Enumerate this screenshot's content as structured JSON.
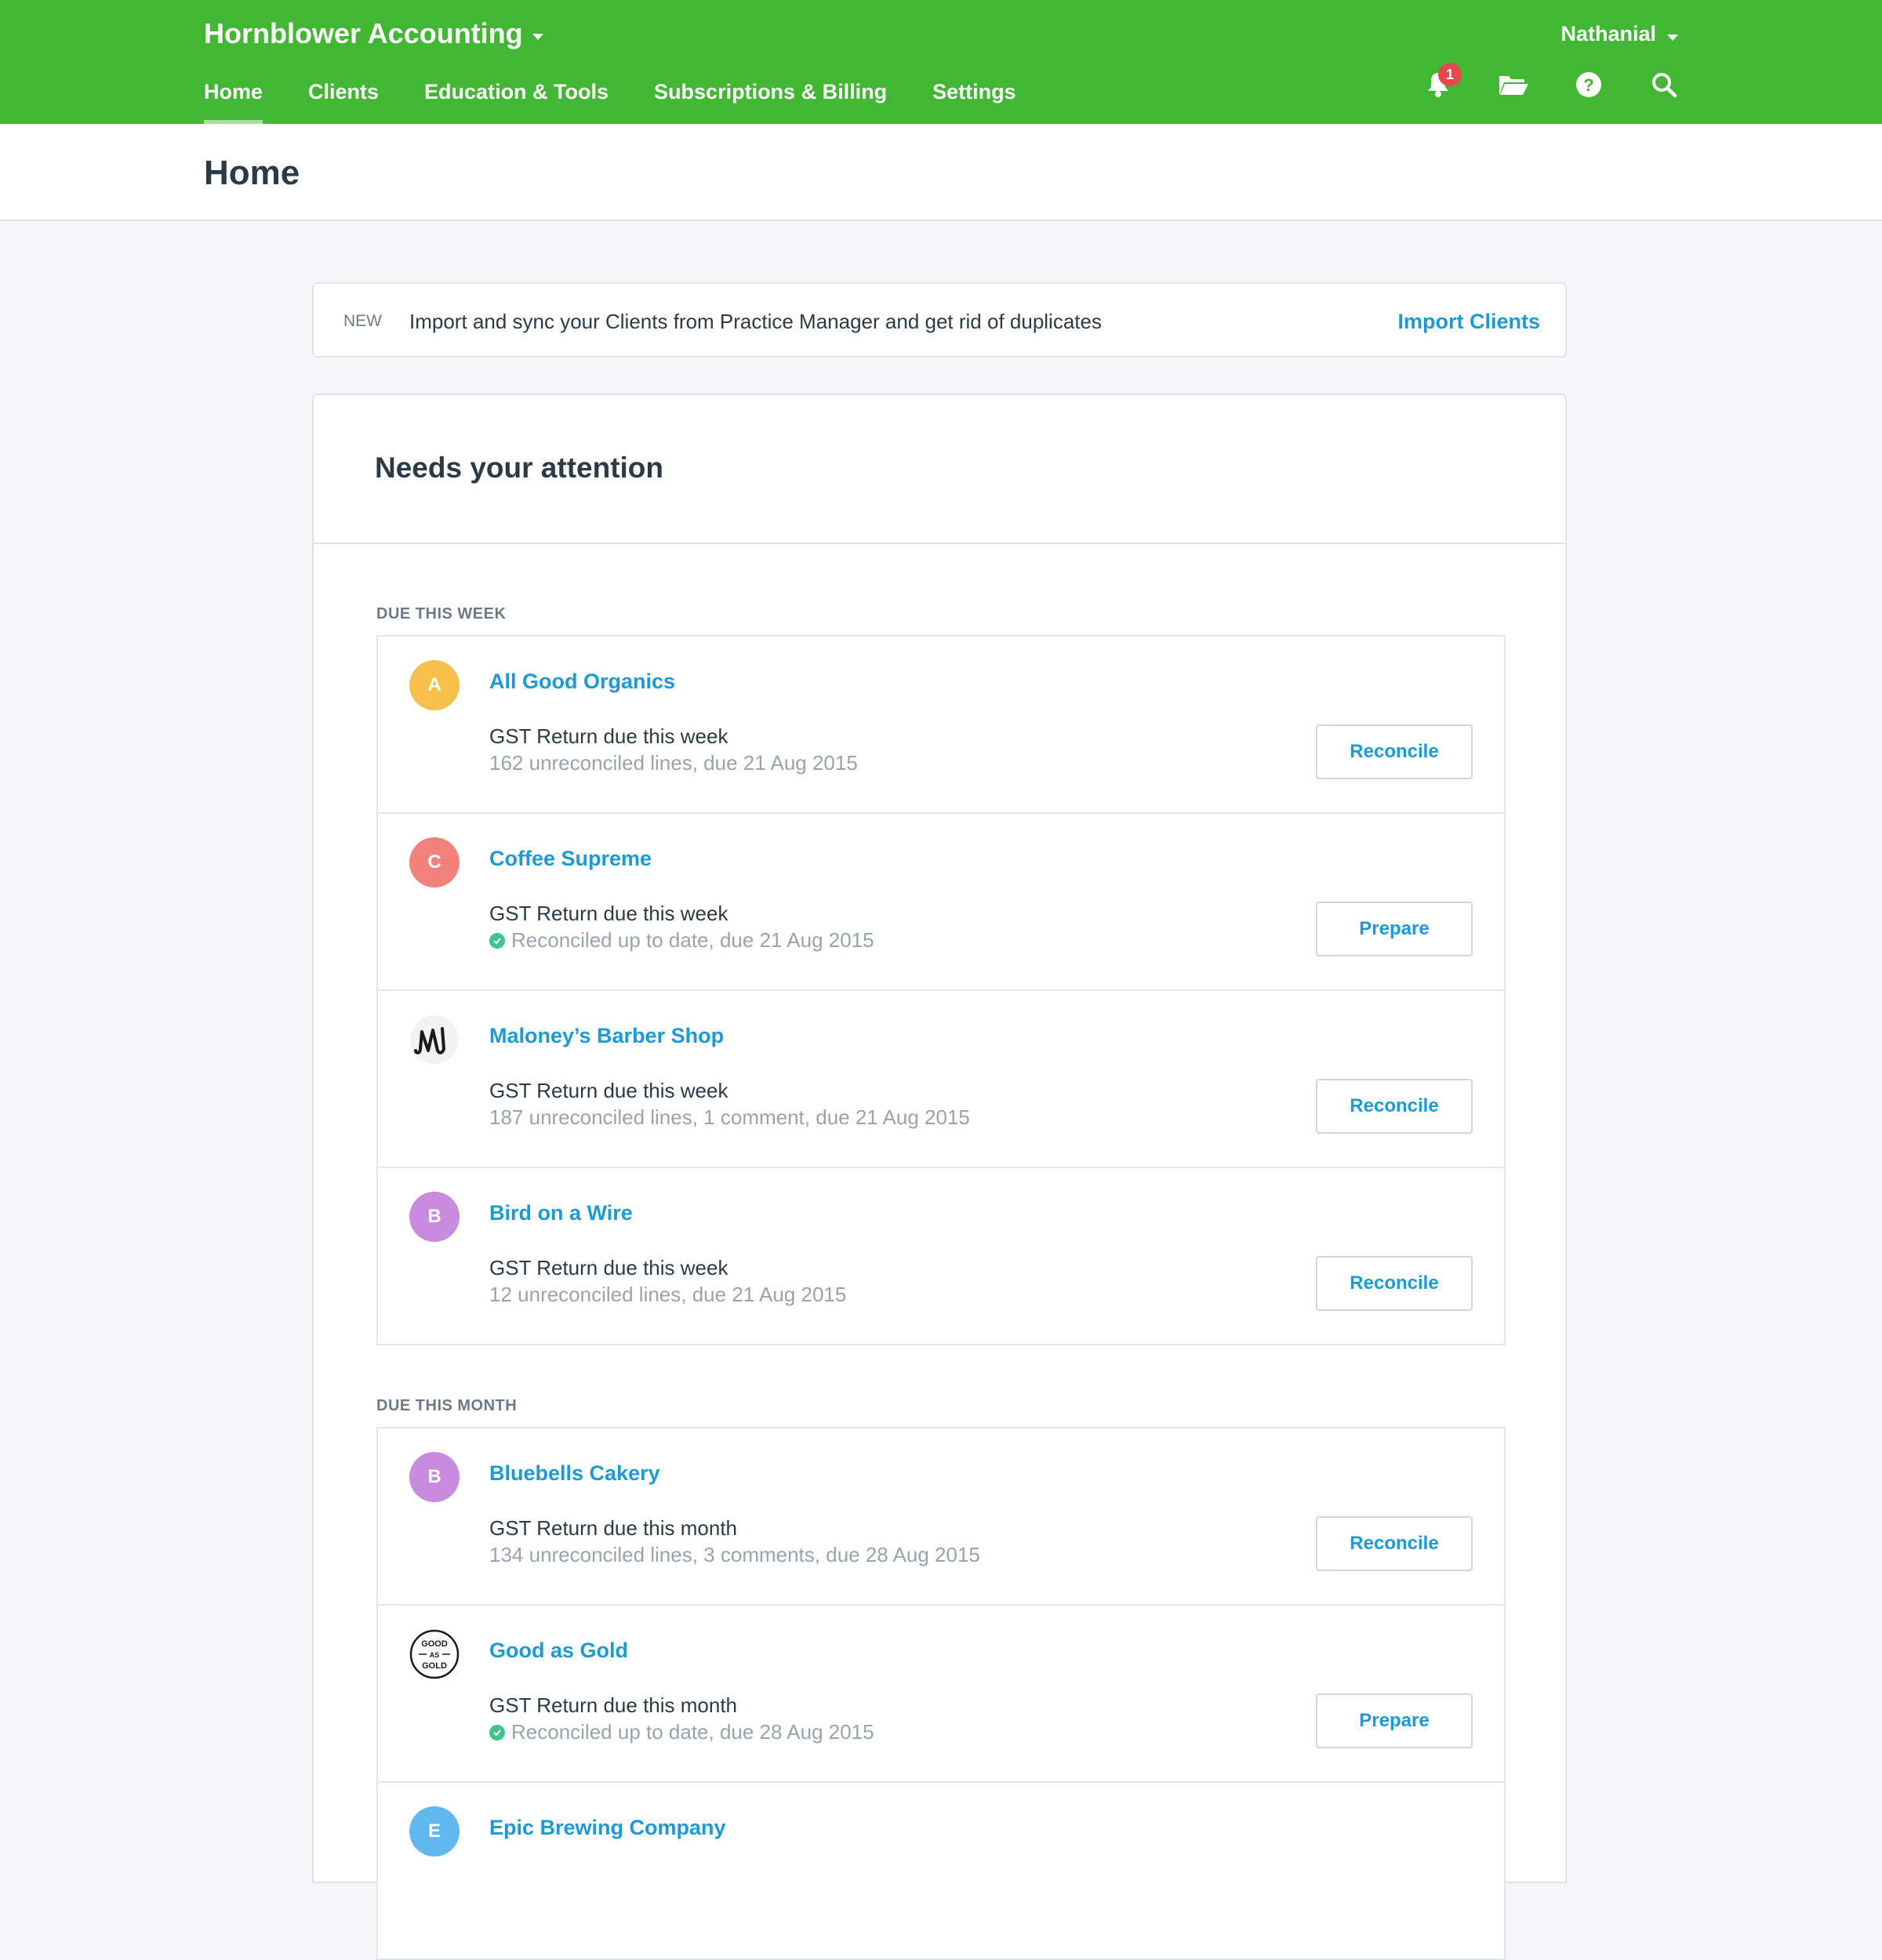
{
  "app": {
    "org_name": "Hornblower Accounting",
    "user_name": "Nathanial",
    "notification_count": "1",
    "brand_color": "#41b734",
    "link_color": "#1b9ad6"
  },
  "nav": {
    "items": [
      {
        "label": "Home",
        "active": true
      },
      {
        "label": "Clients"
      },
      {
        "label": "Education & Tools"
      },
      {
        "label": "Subscriptions & Billing"
      },
      {
        "label": "Settings"
      }
    ]
  },
  "header_icons": [
    "bell-icon",
    "folder-icon",
    "help-icon",
    "search-icon"
  ],
  "page": {
    "title": "Home"
  },
  "banner": {
    "tag": "NEW",
    "text": "Import and sync your Clients from Practice Manager and get rid of duplicates",
    "link": "Import Clients"
  },
  "attention": {
    "title": "Needs your attention",
    "sections": [
      {
        "label": "DUE THIS WEEK",
        "rows": [
          {
            "initial": "A",
            "avatar_color": "#f7c04a",
            "name": "All Good Organics",
            "task": "GST Return due this week",
            "detail": "162 unreconciled lines, due 21 Aug 2015",
            "action": "Reconcile"
          },
          {
            "initial": "C",
            "avatar_color": "#f2817b",
            "name": "Coffee Supreme",
            "task": "GST Return due this week",
            "detail": "Reconciled up to date, due 21 Aug 2015",
            "action": "Prepare",
            "reconciled": true
          },
          {
            "logo": "m-script-logo",
            "name": "Maloney’s Barber Shop",
            "task": "GST Return due this week",
            "detail": "187 unreconciled lines, 1 comment, due 21 Aug 2015",
            "action": "Reconcile"
          },
          {
            "initial": "B",
            "avatar_color": "#c98bdf",
            "name": "Bird on a Wire",
            "task": "GST Return due this week",
            "detail": "12 unreconciled lines, due 21 Aug 2015",
            "action": "Reconcile"
          }
        ]
      },
      {
        "label": "DUE THIS MONTH",
        "rows": [
          {
            "initial": "B",
            "avatar_color": "#c98bdf",
            "name": "Bluebells Cakery",
            "task": "GST Return due this month",
            "detail": "134 unreconciled lines, 3 comments, due 28 Aug 2015",
            "action": "Reconcile"
          },
          {
            "logo": "good-as-gold-logo",
            "logo_text": [
              "GOOD",
              "AS",
              "GOLD"
            ],
            "name": "Good as Gold",
            "task": "GST Return due this month",
            "detail": "Reconciled up to date, due 28 Aug 2015",
            "action": "Prepare",
            "reconciled": true
          },
          {
            "initial": "E",
            "avatar_color": "#5fb8ee",
            "name": "Epic Brewing Company"
          }
        ]
      }
    ]
  }
}
